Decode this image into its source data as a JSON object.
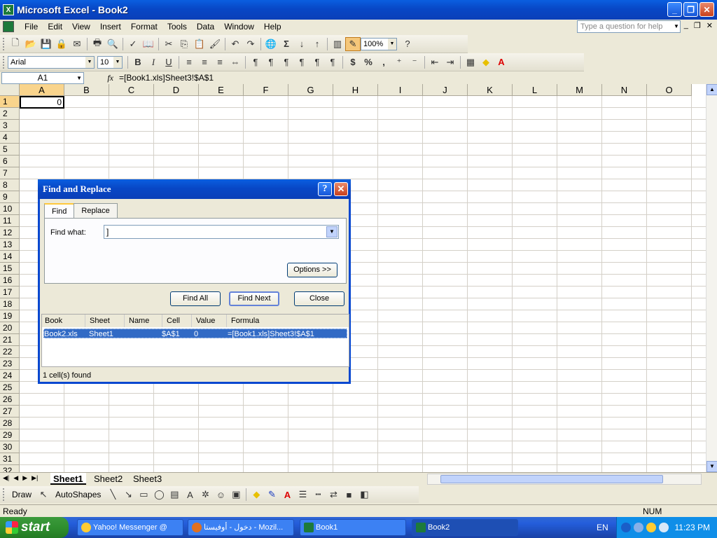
{
  "window": {
    "title": "Microsoft Excel - Book2"
  },
  "menu": [
    "File",
    "Edit",
    "View",
    "Insert",
    "Format",
    "Tools",
    "Data",
    "Window",
    "Help"
  ],
  "help_box": {
    "placeholder": "Type a question for help"
  },
  "toolbar": {
    "zoom": "100%",
    "sigma": "Σ"
  },
  "format_toolbar": {
    "font": "Arial",
    "size": "10",
    "bold": "B",
    "italic": "I",
    "underline": "U",
    "currency": "$",
    "percent": "%",
    "comma": ","
  },
  "formula_bar": {
    "name_box": "A1",
    "fx": "fx",
    "formula": "=[Book1.xls]Sheet3!$A$1"
  },
  "grid": {
    "columns": [
      "A",
      "B",
      "C",
      "D",
      "E",
      "F",
      "G",
      "H",
      "I",
      "J",
      "K",
      "L",
      "M",
      "N",
      "O"
    ],
    "rows": [
      "1",
      "2",
      "3",
      "4",
      "5",
      "6",
      "7",
      "8",
      "9",
      "10",
      "11",
      "12",
      "13",
      "14",
      "15",
      "16",
      "17",
      "18",
      "19",
      "20",
      "21",
      "22",
      "23",
      "24",
      "25",
      "26",
      "27",
      "28",
      "29",
      "30",
      "31",
      "32"
    ],
    "a1_value": "0"
  },
  "sheets": [
    "Sheet1",
    "Sheet2",
    "Sheet3"
  ],
  "draw_toolbar": {
    "draw": "Draw",
    "autoshapes": "AutoShapes"
  },
  "status": {
    "left": "Ready",
    "right": "NUM"
  },
  "dialog": {
    "title": "Find and Replace",
    "help": "?",
    "tabs": [
      "Find",
      "Replace"
    ],
    "find_label": "Find what:",
    "find_value": "]",
    "options_button": "Options >>",
    "find_all": "Find All",
    "find_next": "Find Next",
    "close": "Close",
    "columns": [
      "Book",
      "Sheet",
      "Name",
      "Cell",
      "Value",
      "Formula"
    ],
    "result": {
      "book": "Book2.xls",
      "sheet": "Sheet1",
      "name": "",
      "cell": "$A$1",
      "value": "0",
      "formula": "=[Book1.xls]Sheet3!$A$1"
    },
    "status": "1 cell(s) found"
  },
  "taskbar": {
    "start": "start",
    "items": [
      "Yahoo! Messenger @",
      "دخول - أوفيستا - Mozil...",
      "Book1",
      "Book2"
    ],
    "lang": "EN",
    "clock": "11:23 PM"
  }
}
